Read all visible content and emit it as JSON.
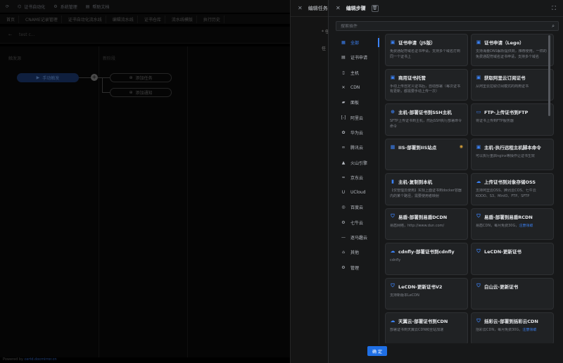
{
  "background": {
    "topbar": [
      "证书自动化",
      "系统管理",
      "帮助文档"
    ],
    "tabs": [
      "首页",
      "CNAME记录管理",
      "证书自动化流水线",
      "编辑流水线",
      "证书仓库",
      "流水线模版",
      "执行历史"
    ],
    "crumb": "test c...",
    "col_trigger": "触发源",
    "col_new": "新阶段",
    "node_trigger": "手动触发",
    "node_add_task": "添加任务",
    "node_add_notice": "添加通知",
    "footer_prefix": "Powered by ",
    "footer_link": "certd.docmirror.cn"
  },
  "drawer_task": {
    "title": "编辑任务",
    "frag1": "* 任",
    "frag2": "任"
  },
  "drawer_step": {
    "title": "编辑步骤",
    "search_placeholder": "搜索插件",
    "confirm": "确 定",
    "categories": [
      {
        "icon": "grid-icon",
        "glyph": "▦",
        "label": "全部",
        "active": true
      },
      {
        "icon": "cert-icon",
        "glyph": "▤",
        "label": "证书申请"
      },
      {
        "icon": "server-icon",
        "glyph": "▯",
        "label": "主机"
      },
      {
        "icon": "cdn-icon",
        "glyph": "✕",
        "label": "CDN"
      },
      {
        "icon": "panel-icon",
        "glyph": "▰",
        "label": "面板"
      },
      {
        "icon": "aliyun-icon",
        "glyph": "[-]",
        "label": "阿里云"
      },
      {
        "icon": "huawei-icon",
        "glyph": "✿",
        "label": "华为云"
      },
      {
        "icon": "tencent-icon",
        "glyph": "∞",
        "label": "腾讯云"
      },
      {
        "icon": "volcengine-icon",
        "glyph": "▲",
        "label": "火山引擎"
      },
      {
        "icon": "jdcloud-icon",
        "glyph": "≈",
        "label": "京东云"
      },
      {
        "icon": "ucloud-icon",
        "glyph": "U",
        "label": "UCloud"
      },
      {
        "icon": "baidu-icon",
        "glyph": "◎",
        "label": "百度云"
      },
      {
        "icon": "qiniu-icon",
        "glyph": "⚙",
        "label": "七牛云"
      },
      {
        "icon": "upyun-icon",
        "glyph": "—",
        "label": "逐马趣云"
      },
      {
        "icon": "other-icon",
        "glyph": "⌂",
        "label": "其他"
      },
      {
        "icon": "admin-icon",
        "glyph": "⚙",
        "label": "管理"
      }
    ],
    "plugins": [
      {
        "icon": "cert-icon",
        "glyph": "▣",
        "title": "证书申请（JS版）",
        "desc": "免费通配符域名证书申请，支持多个域名打到同一个证书上"
      },
      {
        "icon": "cert-icon",
        "glyph": "▣",
        "title": "证书申请（Lego）",
        "desc": "支持海量DNS解析提供商，推荐使用，一样的免费通配符域名证书申请，支持多个域名"
      },
      {
        "icon": "cert-icon",
        "glyph": "▣",
        "title": "商用证书托管",
        "desc": "手动上传自定义证书后，自动部署（每次证书有更新，都需要手动上传一次）"
      },
      {
        "icon": "cert-icon",
        "glyph": "▣",
        "title": "获取阿里云订阅证书",
        "desc": "从阿里云拉取订阅模式的商用证书"
      },
      {
        "icon": "ssh-icon",
        "glyph": "⊕",
        "title": "主机-部署证书到SSH主机",
        "desc": "SFTP上传证书到主机，然后SSH执行部署命令命令"
      },
      {
        "icon": "folder-icon",
        "glyph": "▭",
        "title": "FTP-上传证书到FTP",
        "desc": "将证书上传到FTP服务器"
      },
      {
        "icon": "iis-icon",
        "glyph": "▦",
        "title": "IIS-部署到IIS站点",
        "desc": "",
        "eye": true
      },
      {
        "icon": "script-icon",
        "glyph": "▣",
        "title": "主机-执行远程主机脚本命令",
        "desc": "可以执行重启nginx等操作让证书生效"
      },
      {
        "icon": "copy-icon",
        "glyph": "▮",
        "title": "主机-复制到本机",
        "desc": "【仅管理员使用】实现上面证书到docker容器内的某个路径，需要使用者映射"
      },
      {
        "icon": "cloud-upload-icon",
        "glyph": "☁",
        "title": "上传证书到对象存储OSS",
        "desc": "支持阿里云OSS、腾讯云COS、七牛云KODO、S3、MinIO、FTP、SFTP"
      },
      {
        "icon": "shield-icon",
        "glyph": "⛉",
        "title": "易盾-部署到易盾DCDN",
        "desc": "易盾网络，http://www.dun.com/"
      },
      {
        "icon": "shield-icon",
        "glyph": "⛉",
        "title": "易盾-部署到易盾RCDN",
        "desc": "易盾CDN，每月免费30G，",
        "link": "注册领取"
      },
      {
        "icon": "cloud-icon",
        "glyph": "☁",
        "title": "cdnfly-部署证书到cdnfly",
        "desc": "cdnfly"
      },
      {
        "icon": "shield-icon",
        "glyph": "⛉",
        "title": "LeCDN-更新证书",
        "desc": ""
      },
      {
        "icon": "shield-icon",
        "glyph": "⛉",
        "title": "LeCDN-更新证书V2",
        "desc": "支持新版本LeCDN"
      },
      {
        "icon": "shield-icon",
        "glyph": "⛉",
        "title": "白山云-更新证书",
        "desc": ""
      },
      {
        "icon": "tianyi-icon",
        "glyph": "☁",
        "title": "天翼云-部署证书到CDN",
        "desc": "部署证书到天翼云CDN和全站加速"
      },
      {
        "icon": "shield-icon",
        "glyph": "⛉",
        "title": "括彩云-部署到括彩云CDN",
        "desc": "括彩云CDN，每月免费30G，",
        "link": "注册领取"
      }
    ]
  }
}
